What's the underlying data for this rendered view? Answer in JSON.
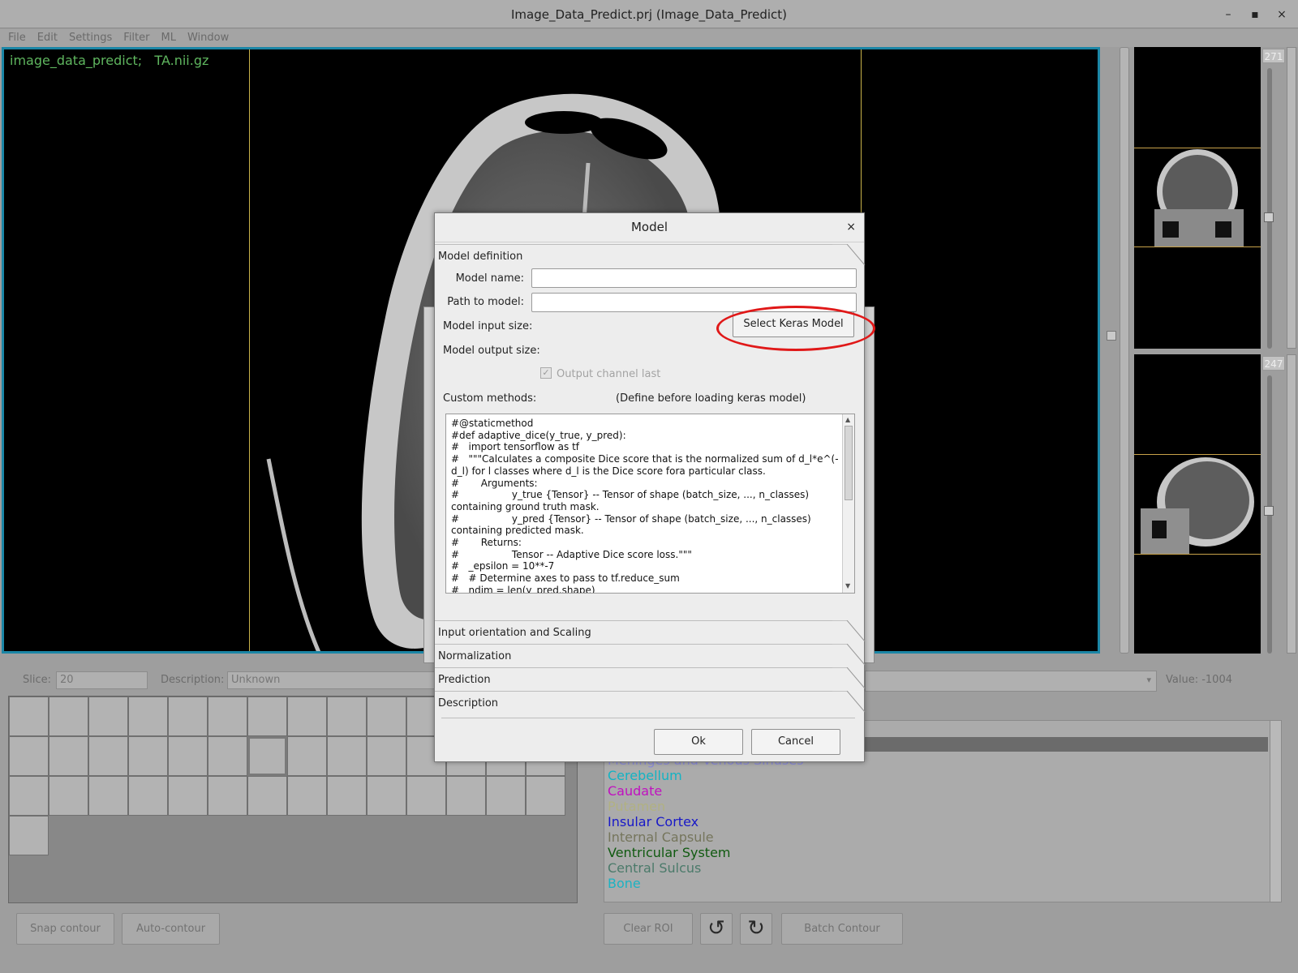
{
  "window": {
    "title": "Image_Data_Predict.prj (Image_Data_Predict)",
    "minimize": "–",
    "maximize": "▪",
    "close": "×"
  },
  "menu": [
    "File",
    "Edit",
    "Settings",
    "Filter",
    "ML",
    "Window"
  ],
  "viewer": {
    "label": "image_data_predict;   TA.nii.gz"
  },
  "thumbnails": {
    "top_number": "271",
    "bottom_number": "247"
  },
  "slice_bar": {
    "slice_label": "Slice:",
    "slice_value": "20",
    "description_label": "Description:",
    "description_value": "Unknown",
    "value_label": "Value: -1004"
  },
  "left_buttons": {
    "snap": "Snap contour",
    "auto": "Auto-contour"
  },
  "roi_list": [
    {
      "name": "Meninges and Venous Sinuses",
      "color": "#8b8bd8"
    },
    {
      "name": "Cerebellum",
      "color": "#13b3c3"
    },
    {
      "name": "Caudate",
      "color": "#c011c0"
    },
    {
      "name": "Putamen",
      "color": "#b1b182"
    },
    {
      "name": "Insular Cortex",
      "color": "#1818c8"
    },
    {
      "name": "Internal Capsule",
      "color": "#75755c"
    },
    {
      "name": "Ventricular System",
      "color": "#105a10"
    },
    {
      "name": "Central Sulcus",
      "color": "#4b7a6a"
    },
    {
      "name": "Bone",
      "color": "#1db2c2"
    }
  ],
  "right_buttons": {
    "clear_roi": "Clear ROI",
    "undo": "↺",
    "redo": "↻",
    "batch": "Batch Contour"
  },
  "dialog": {
    "title": "Model",
    "close": "×",
    "section_model_definition": "Model definition",
    "model_name_label": "Model name:",
    "model_name_value": "",
    "path_label": "Path to model:",
    "path_value": "",
    "input_size_label": "Model input size:",
    "output_size_label": "Model output size:",
    "select_button": "Select Keras Model",
    "channel_last_label": "Output channel last",
    "custom_methods_label": "Custom methods:",
    "custom_methods_note": "(Define before loading keras model)",
    "code": "#@staticmethod\n#def adaptive_dice(y_true, y_pred):\n#   import tensorflow as tf\n#   \"\"\"Calculates a composite Dice score that is the normalized sum of d_l*e^(-d_l) for l classes where d_l is the Dice score fora particular class.\n#       Arguments:\n#                 y_true {Tensor} -- Tensor of shape (batch_size, ..., n_classes) containing ground truth mask.\n#                 y_pred {Tensor} -- Tensor of shape (batch_size, ..., n_classes) containing predicted mask.\n#       Returns:\n#                 Tensor -- Adaptive Dice score loss.\"\"\"\n#   _epsilon = 10**-7\n#   # Determine axes to pass to tf.reduce_sum\n#   ndim = len(y_pred.shape)",
    "section_input": "Input orientation and Scaling",
    "section_normalization": "Normalization",
    "section_prediction": "Prediction",
    "section_description": "Description",
    "ok": "Ok",
    "cancel": "Cancel"
  }
}
